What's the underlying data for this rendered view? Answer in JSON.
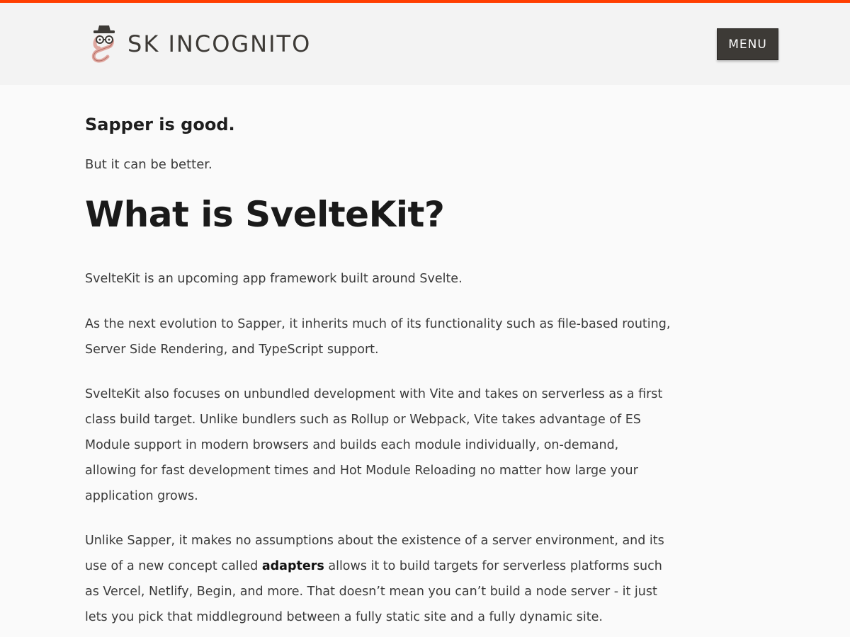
{
  "header": {
    "brand_name": "SK INCOGNITO",
    "menu_label": "MENU"
  },
  "colors": {
    "accent": "#ff3e00",
    "menu_bg": "#3d3a36",
    "header_bg": "#f3f3f3",
    "page_bg": "#fafafa"
  },
  "icons": {
    "logo": "incognito-face-logo-icon"
  },
  "article": {
    "lead_title": "Sapper is good.",
    "lead_subtitle": "But it can be better.",
    "heading": "What is SvelteKit?",
    "p1": "SvelteKit is an upcoming app framework built around Svelte.",
    "p2": "As the next evolution to Sapper, it inherits much of its functionality such as file-based routing, Server Side Rendering, and TypeScript support.",
    "p3": "SvelteKit also focuses on unbundled development with Vite and takes on serverless as a first class build target. Unlike bundlers such as Rollup or Webpack, Vite takes advantage of ES Module support in modern browsers and builds each module individually, on-demand, allowing for fast development times and Hot Module Reloading no matter how large your application grows.",
    "p4_before": "Unlike Sapper, it makes no assumptions about the existence of a server environment, and its use of a new concept called ",
    "p4_strong": "adapters",
    "p4_after": " allows it to build targets for serverless platforms such as Vercel, Netlify, Begin, and more. That doesn’t mean you can’t build a node server - it just lets you pick that middleground between a fully static site and a fully dynamic site."
  }
}
